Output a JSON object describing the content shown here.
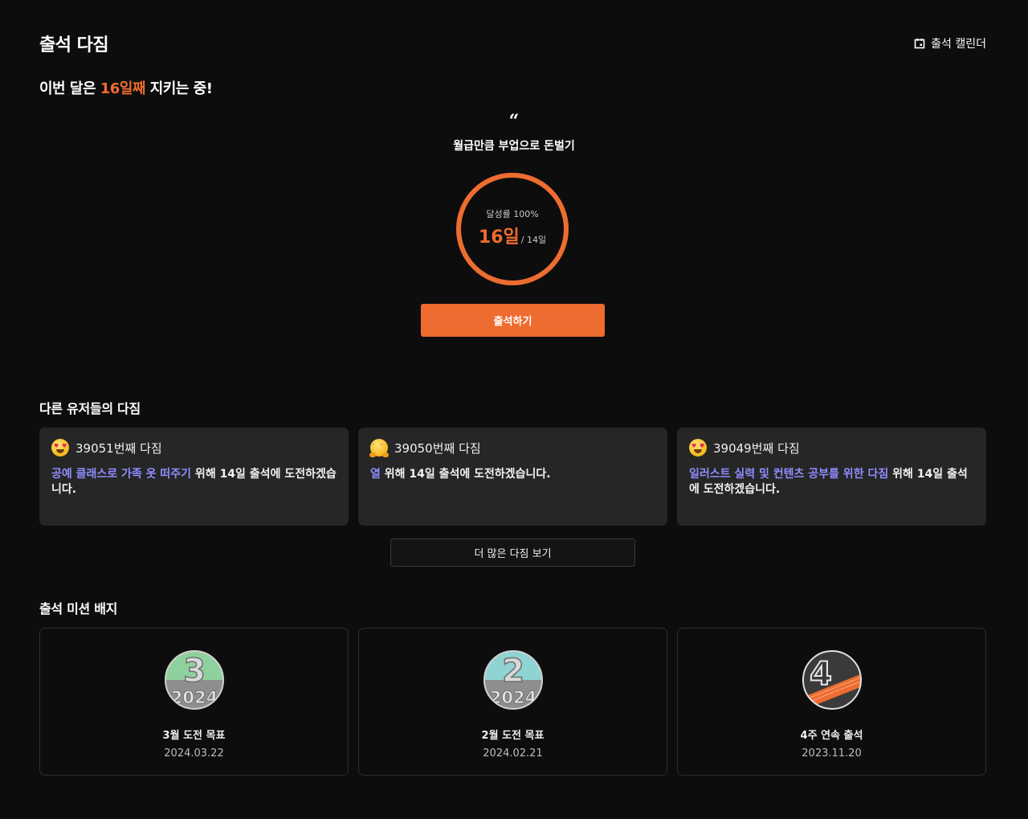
{
  "header": {
    "title": "출석 다짐",
    "calendar_label": "출석 캘린더",
    "calendar_icon": "calendar-icon"
  },
  "headline": {
    "prefix": "이번 달은 ",
    "accent": "16일째",
    "suffix": " 지키는 중!"
  },
  "goal": {
    "quote_mark": "“",
    "text": "월급만큼 부업으로 돈벌기"
  },
  "progress": {
    "rate_label": "달성률 100%",
    "rate_fraction": 1.0,
    "days": "16일",
    "target": "/ 14일"
  },
  "attend_button_label": "출석하기",
  "colors": {
    "accent": "#ee6c2f",
    "link": "#8f8cff",
    "background": "#0d0d0d",
    "card": "#262626"
  },
  "others": {
    "title": "다른 유저들의 다짐",
    "cards": [
      {
        "emoji": "heart-eyes-emoji",
        "number": "39051번째 다짐",
        "goal": "공예 클래스로 가족 옷 떠주기",
        "rest": " 위해 14일 출석에 도전하겠습니다."
      },
      {
        "emoji": "hugging-face-emoji",
        "number": "39050번째 다짐",
        "goal": "열",
        "rest": " 위해 14일 출석에 도전하겠습니다."
      },
      {
        "emoji": "heart-eyes-emoji",
        "number": "39049번째 다짐",
        "goal": "일러스트 실력 및 컨텐츠 공부를 위한 다짐",
        "rest": " 위해 14일 출석에 도전하겠습니다."
      }
    ],
    "more_label": "더 많은 다짐 보기"
  },
  "badges": {
    "title": "출석 미션 배지",
    "items": [
      {
        "icon": "march-2024-badge-icon",
        "title": "3월 도전 목표",
        "date": "2024.03.22",
        "numeral": "3",
        "color": "#8fd19e"
      },
      {
        "icon": "february-2024-badge-icon",
        "title": "2월 도전 목표",
        "date": "2024.02.21",
        "numeral": "2",
        "color": "#8fd3d2"
      },
      {
        "icon": "four-week-streak-badge-icon",
        "title": "4주 연속 출석",
        "date": "2023.11.20",
        "numeral": "4",
        "color": "#ee6c2f"
      }
    ]
  }
}
